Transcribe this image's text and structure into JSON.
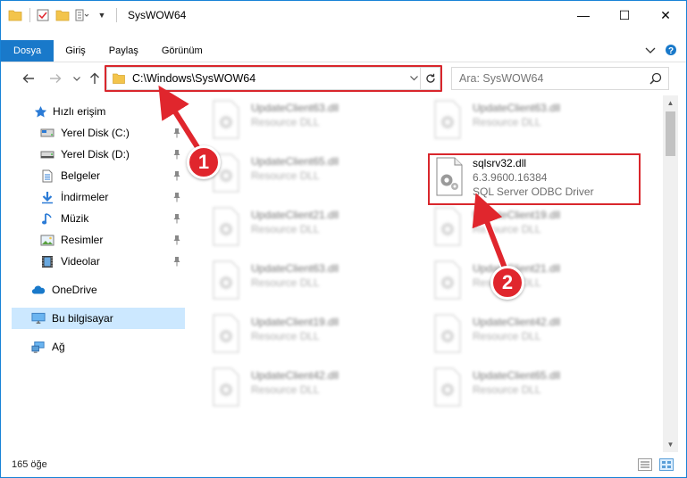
{
  "window": {
    "title": "SysWOW64",
    "controls": {
      "minimize": "—",
      "maximize": "☐",
      "close": "✕"
    }
  },
  "ribbon": {
    "tabs": [
      {
        "label": "Dosya",
        "active": true
      },
      {
        "label": "Giriş"
      },
      {
        "label": "Paylaş"
      },
      {
        "label": "Görünüm"
      }
    ],
    "expand_icon": "chevron-down-icon",
    "help_icon": "help-icon"
  },
  "address": {
    "path": "C:\\Windows\\SysWOW64",
    "search_placeholder": "Ara: SysWOW64"
  },
  "nav": {
    "items": [
      {
        "label": "Hızlı erişim",
        "icon": "star-icon"
      },
      {
        "label": "Yerel Disk (C:)",
        "icon": "drive-icon",
        "pinned": true
      },
      {
        "label": "Yerel Disk (D:)",
        "icon": "drive-icon",
        "pinned": true
      },
      {
        "label": "Belgeler",
        "icon": "documents-icon",
        "pinned": true
      },
      {
        "label": "İndirmeler",
        "icon": "download-icon",
        "pinned": true
      },
      {
        "label": "Müzik",
        "icon": "music-icon",
        "pinned": true
      },
      {
        "label": "Resimler",
        "icon": "pictures-icon",
        "pinned": true
      },
      {
        "label": "Videolar",
        "icon": "videos-icon",
        "pinned": true
      },
      {
        "label": "OneDrive",
        "icon": "cloud-icon"
      },
      {
        "label": "Bu bilgisayar",
        "icon": "computer-icon",
        "selected": true
      },
      {
        "label": "Ağ",
        "icon": "network-icon"
      }
    ]
  },
  "files": {
    "left_column": [
      {
        "name": "UpdateClient63.dll",
        "type": "Resource DLL"
      },
      {
        "name": "UpdateClient65.dll",
        "type": "Resource DLL"
      },
      {
        "name": "UpdateClient21.dll",
        "type": "Resource DLL"
      },
      {
        "name": "UpdateClient63.dll",
        "type": "Resource DLL"
      },
      {
        "name": "UpdateClient19.dll",
        "type": "Resource DLL"
      },
      {
        "name": "UpdateClient42.dll",
        "type": "Resource DLL"
      }
    ],
    "right_column": [
      {
        "name": "UpdateClient63.dll",
        "type": "Resource DLL"
      },
      {
        "name": "sqlsrv32.dll",
        "version": "6.3.9600.16384",
        "description": "SQL Server ODBC Driver",
        "highlighted": true
      },
      {
        "name": "UpdateClient19.dll",
        "type": "Resource DLL"
      },
      {
        "name": "UpdateClient21.dll",
        "type": "Resource DLL"
      },
      {
        "name": "UpdateClient42.dll",
        "type": "Resource DLL"
      },
      {
        "name": "UpdateClient65.dll",
        "type": "Resource DLL"
      }
    ]
  },
  "status": {
    "item_count": "165 öğe"
  },
  "callouts": {
    "one": "1",
    "two": "2"
  },
  "colors": {
    "accent": "#1979ca",
    "highlight": "#d9262c",
    "selected_bg": "#cce8ff"
  }
}
